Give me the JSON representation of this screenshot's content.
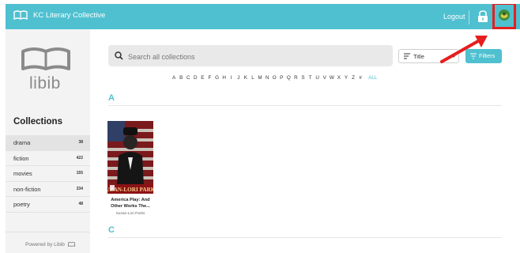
{
  "header": {
    "app_name": "KC Literary Collective",
    "logout_label": "Logout"
  },
  "sidebar": {
    "logo_text": "libib",
    "collections_title": "Collections",
    "items": [
      {
        "label": "drama",
        "count": "38",
        "active": true
      },
      {
        "label": "fiction",
        "count": "422"
      },
      {
        "label": "movies",
        "count": "155"
      },
      {
        "label": "non-fiction",
        "count": "334"
      },
      {
        "label": "poetry",
        "count": "48"
      }
    ],
    "powered_by": "Powered by Libib"
  },
  "search": {
    "placeholder": "Search all collections"
  },
  "sort": {
    "label": "Title"
  },
  "filters": {
    "label": "Filters"
  },
  "alphabet": [
    "A",
    "B",
    "C",
    "D",
    "E",
    "F",
    "G",
    "H",
    "I",
    "J",
    "K",
    "L",
    "M",
    "N",
    "O",
    "P",
    "Q",
    "R",
    "S",
    "T",
    "U",
    "V",
    "W",
    "X",
    "Y",
    "Z",
    "#"
  ],
  "alphabet_all": "ALL",
  "sections": [
    {
      "letter": "A",
      "books": [
        {
          "title": "America Play: And Other Works The...",
          "author": "Suzan-Lori Parks",
          "cover_text": "SUZAN-LORI PARKS"
        }
      ]
    },
    {
      "letter": "C"
    }
  ],
  "colors": {
    "accent": "#4fc0d0",
    "highlight": "#e61e1e"
  }
}
